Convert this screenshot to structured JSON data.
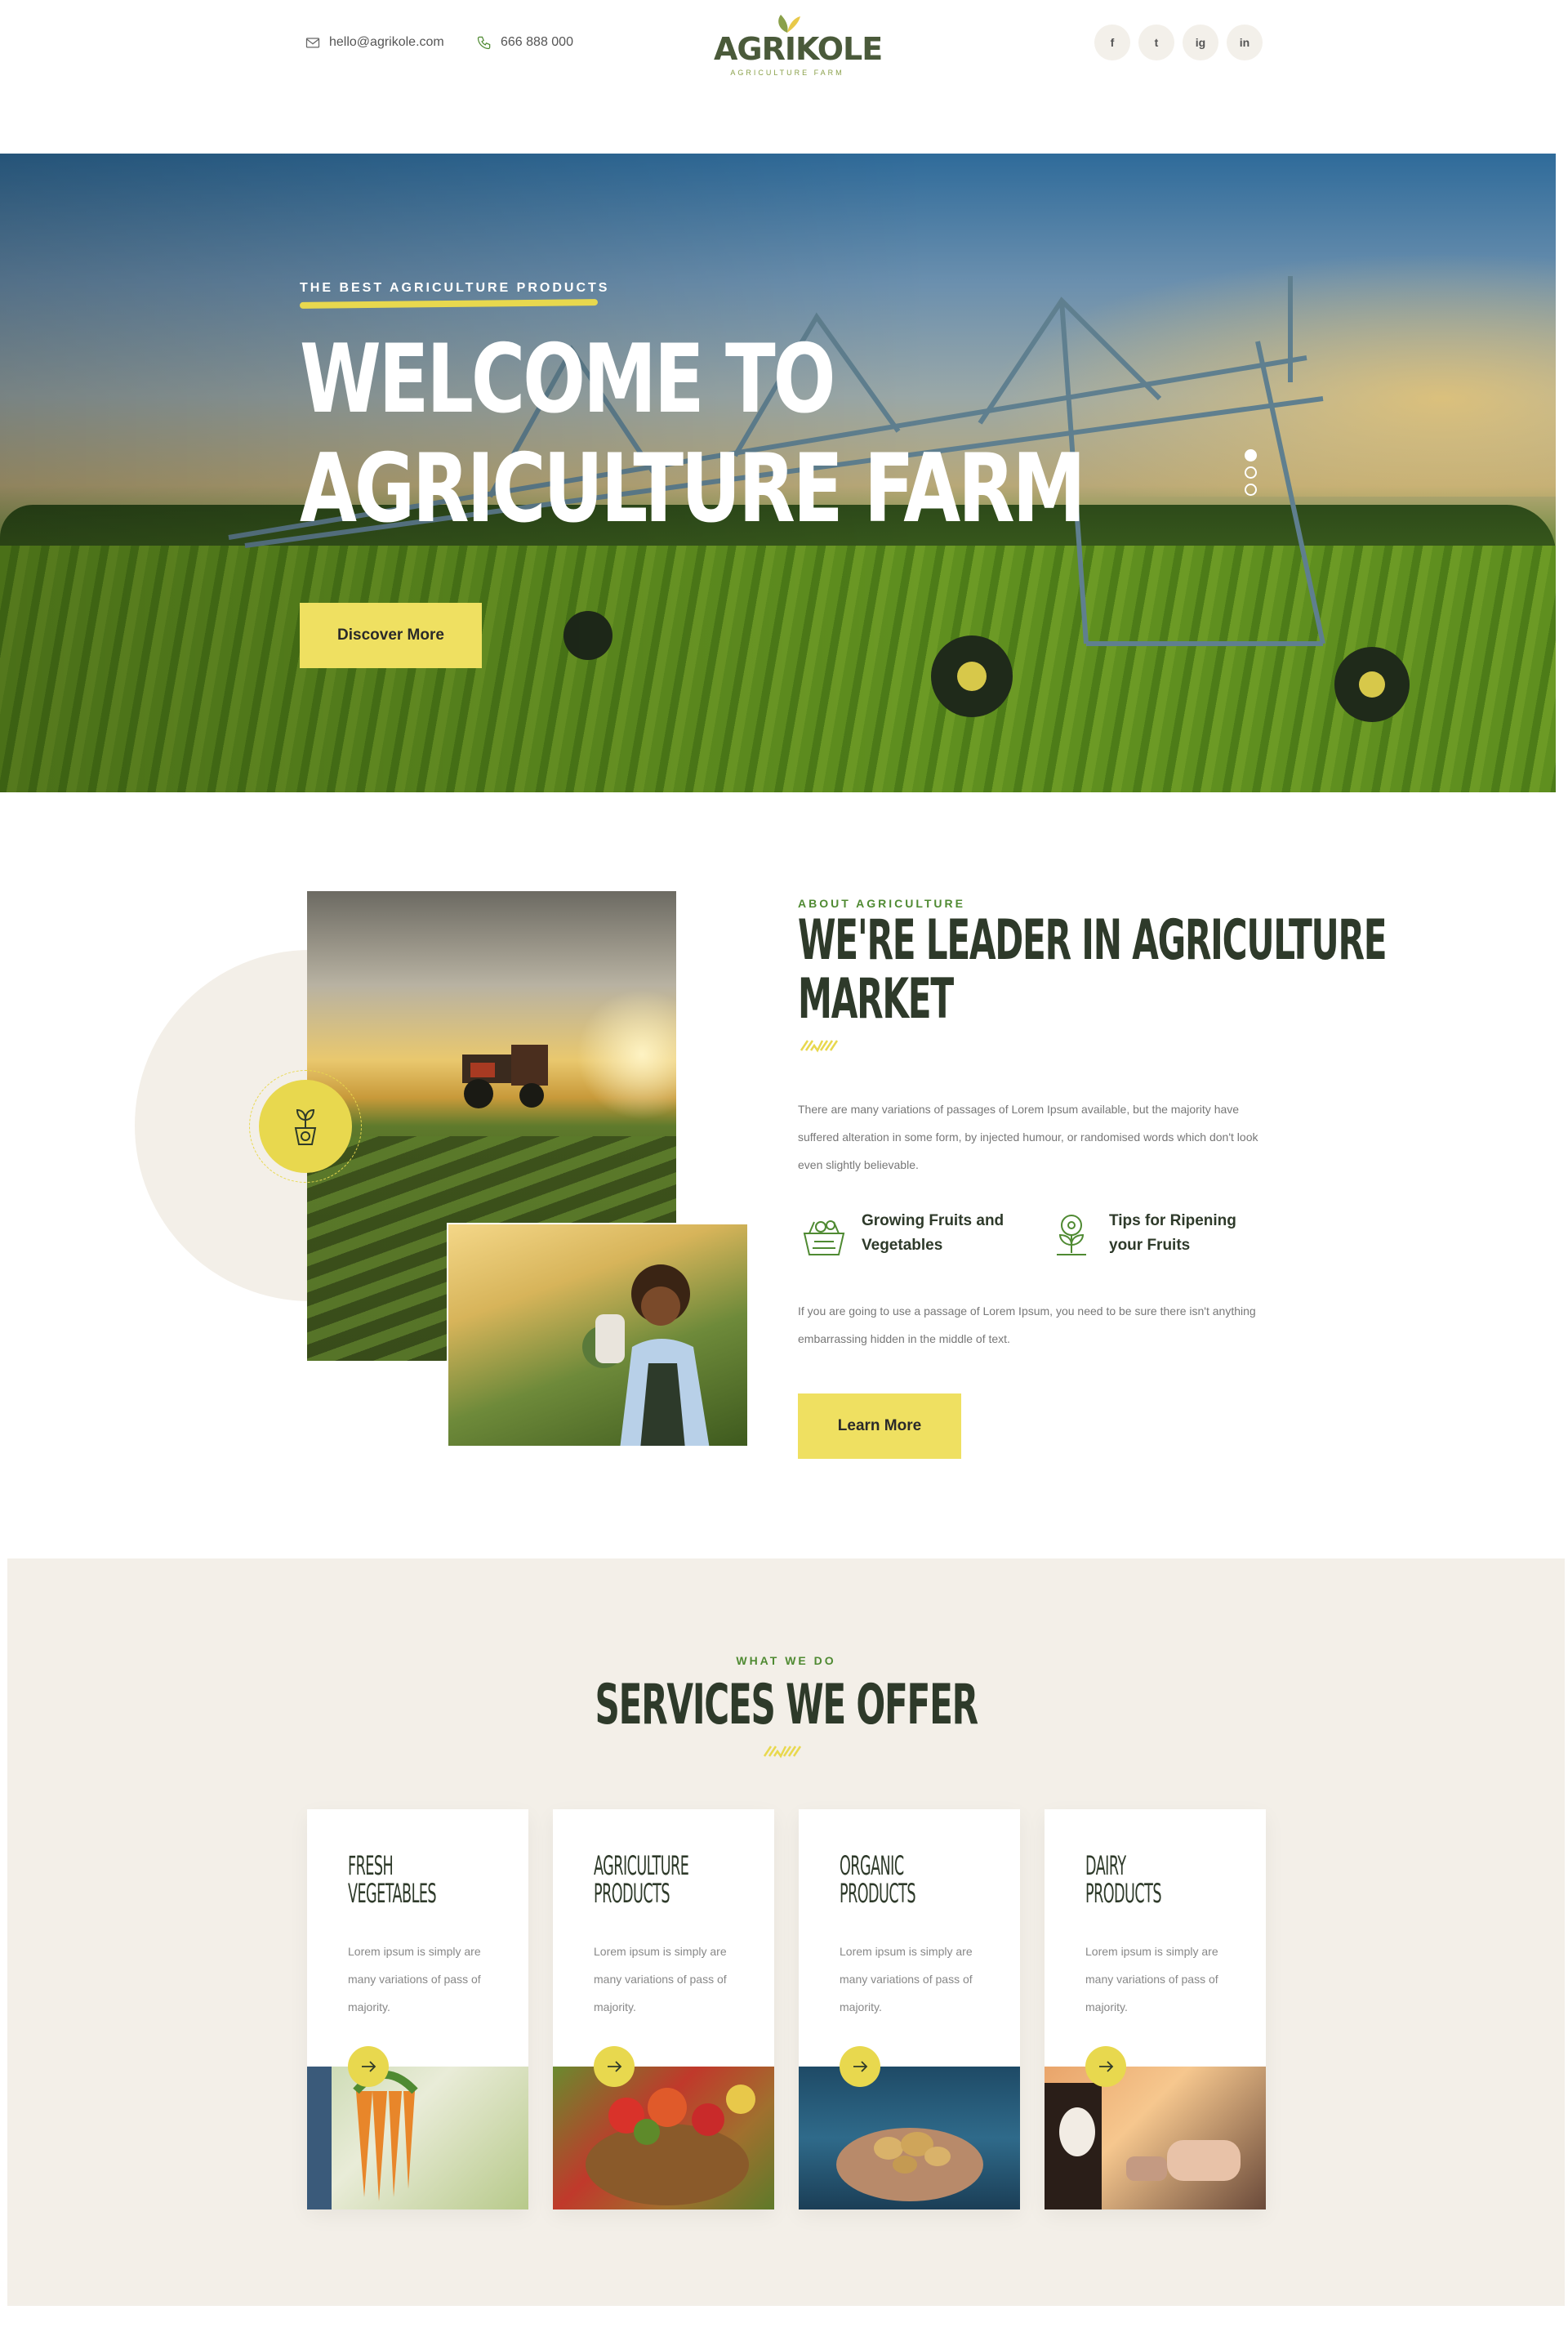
{
  "header": {
    "email": "hello@agrikole.com",
    "phone": "666 888 000",
    "logo_text": "AGRIKOLE",
    "logo_sub": "AGRICULTURE FARM",
    "socials": [
      "f",
      "t",
      "ig",
      "in"
    ]
  },
  "hero": {
    "kicker": "THE BEST AGRICULTURE PRODUCTS",
    "title_line1": "WELCOME TO",
    "title_line2": "AGRICULTURE FARM",
    "button": "Discover More",
    "slides": 3,
    "active_slide": 1
  },
  "about": {
    "kicker": "ABOUT AGRICULTURE",
    "title_line1": "WE'RE LEADER IN AGRICULTURE",
    "title_line2": "MARKET",
    "text1": "There are many variations of passages of Lorem Ipsum available, but the majority have suffered alteration in some form, by injected humour, or randomised words which don't look even slightly believable.",
    "features": [
      {
        "label": "Growing Fruits and Vegetables",
        "icon": "fruit-basket-icon"
      },
      {
        "label": "Tips for Ripening your Fruits",
        "icon": "plant-tips-icon"
      }
    ],
    "text2": "If you are going to use a passage of Lorem Ipsum, you need to be sure there isn't anything embarrassing hidden in the middle of text.",
    "button": "Learn More"
  },
  "services": {
    "kicker": "WHAT WE DO",
    "title": "SERVICES WE OFFER",
    "cards": [
      {
        "title": "FRESH\nVEGETABLES",
        "text": "Lorem ipsum is simply are many variations of pass of majority."
      },
      {
        "title": "AGRICULTURE\nPRODUCTS",
        "text": "Lorem ipsum is simply are many variations of pass of majority."
      },
      {
        "title": "ORGANIC\nPRODUCTS",
        "text": "Lorem ipsum is simply are many variations of pass of majority."
      },
      {
        "title": "DAIRY\nPRODUCTS",
        "text": "Lorem ipsum is simply are many variations of pass of majority."
      }
    ]
  },
  "colors": {
    "accent_yellow": "#efe061",
    "brand_green": "#4f8a32",
    "dark_text": "#2e3a2a",
    "cream_bg": "#f3efe8"
  }
}
